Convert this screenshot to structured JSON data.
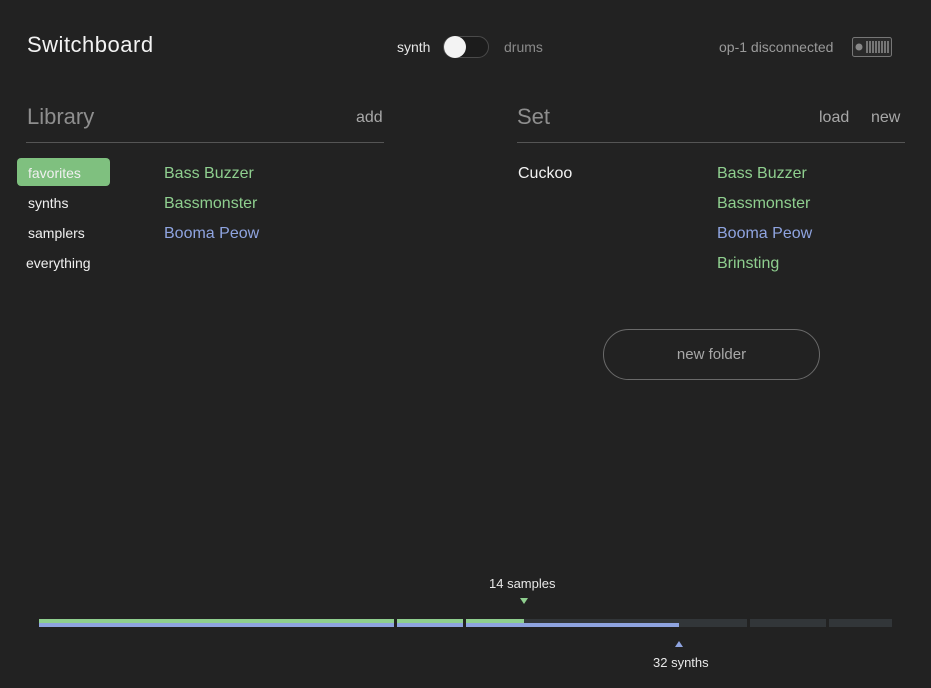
{
  "header": {
    "title": "Switchboard",
    "mode": {
      "left_label": "synth",
      "right_label": "drums",
      "selected": "synth"
    },
    "status": {
      "text": "op-1 disconnected",
      "icon": "keyboard-icon"
    }
  },
  "library": {
    "title": "Library",
    "add_label": "add",
    "categories": [
      {
        "label": "favorites",
        "active": true
      },
      {
        "label": "synths",
        "active": false
      },
      {
        "label": "samplers",
        "active": false
      },
      {
        "label": "everything",
        "active": false
      }
    ],
    "presets": [
      {
        "name": "Bass Buzzer",
        "kind": "synth"
      },
      {
        "name": "Bassmonster",
        "kind": "synth"
      },
      {
        "name": "Booma Peow",
        "kind": "sampler"
      }
    ]
  },
  "set": {
    "title": "Set",
    "load_label": "load",
    "new_label": "new",
    "folder": "Cuckoo",
    "presets": [
      {
        "name": "Bass Buzzer",
        "kind": "synth"
      },
      {
        "name": "Bassmonster",
        "kind": "synth"
      },
      {
        "name": "Booma Peow",
        "kind": "sampler"
      },
      {
        "name": "Brinsting",
        "kind": "synth"
      }
    ],
    "new_folder_label": "new folder"
  },
  "usage": {
    "samples_label": "14 samples",
    "synths_label": "32 synths"
  },
  "colors": {
    "background": "#222222",
    "accent_green": "#8fcf8f",
    "accent_blue": "#8fa4e0"
  }
}
